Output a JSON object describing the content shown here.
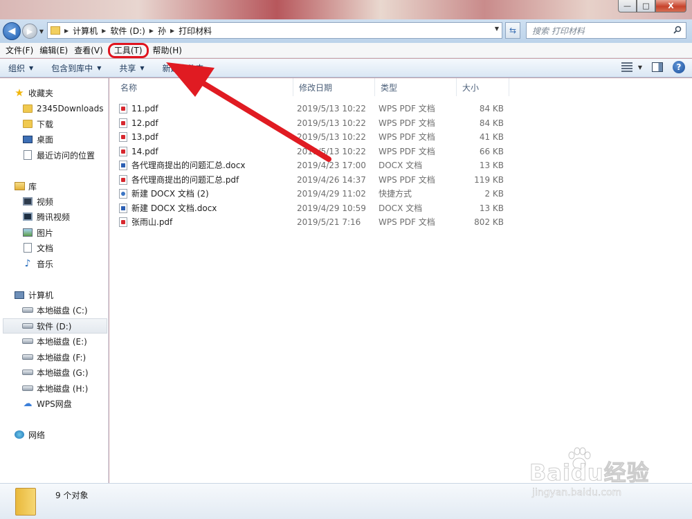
{
  "window": {
    "caption_buttons": {
      "minimize": "—",
      "maximize": "□",
      "close": "X"
    }
  },
  "address_bar": {
    "crumbs": [
      "计算机",
      "软件 (D:)",
      "孙",
      "打印材料"
    ],
    "search_placeholder": "搜索 打印材料"
  },
  "menu": {
    "items": [
      "文件(F)",
      "编辑(E)",
      "查看(V)",
      "工具(T)",
      "帮助(H)"
    ],
    "highlighted": "工具(T)"
  },
  "toolbar": {
    "organize": "组织",
    "include_library": "包含到库中",
    "share": "共享",
    "new_folder": "新建文件夹"
  },
  "nav": {
    "favorites": {
      "label": "收藏夹",
      "items": [
        "2345Downloads",
        "下载",
        "桌面",
        "最近访问的位置"
      ]
    },
    "libraries": {
      "label": "库",
      "items": [
        "视频",
        "腾讯视频",
        "图片",
        "文档",
        "音乐"
      ]
    },
    "computer": {
      "label": "计算机",
      "items": [
        "本地磁盘 (C:)",
        "软件 (D:)",
        "本地磁盘 (E:)",
        "本地磁盘 (F:)",
        "本地磁盘 (G:)",
        "本地磁盘 (H:)",
        "WPS网盘"
      ],
      "selected": "软件 (D:)"
    },
    "network": {
      "label": "网络"
    }
  },
  "columns": {
    "name": "名称",
    "date": "修改日期",
    "type": "类型",
    "size": "大小"
  },
  "files": [
    {
      "name": "11.pdf",
      "date": "2019/5/13 10:22",
      "type": "WPS PDF 文档",
      "size": "84 KB",
      "icon": "pdf"
    },
    {
      "name": "12.pdf",
      "date": "2019/5/13 10:22",
      "type": "WPS PDF 文档",
      "size": "84 KB",
      "icon": "pdf"
    },
    {
      "name": "13.pdf",
      "date": "2019/5/13 10:22",
      "type": "WPS PDF 文档",
      "size": "41 KB",
      "icon": "pdf"
    },
    {
      "name": "14.pdf",
      "date": "2019/5/13 10:22",
      "type": "WPS PDF 文档",
      "size": "66 KB",
      "icon": "pdf"
    },
    {
      "name": "各代理商提出的问题汇总.docx",
      "date": "2019/4/23 17:00",
      "type": "DOCX 文档",
      "size": "13 KB",
      "icon": "docx"
    },
    {
      "name": "各代理商提出的问题汇总.pdf",
      "date": "2019/4/26 14:37",
      "type": "WPS PDF 文档",
      "size": "119 KB",
      "icon": "pdf"
    },
    {
      "name": "新建 DOCX 文档 (2)",
      "date": "2019/4/29 11:02",
      "type": "快捷方式",
      "size": "2 KB",
      "icon": "lnk"
    },
    {
      "name": "新建 DOCX 文档.docx",
      "date": "2019/4/29 10:59",
      "type": "DOCX 文档",
      "size": "13 KB",
      "icon": "docx"
    },
    {
      "name": "张雨山.pdf",
      "date": "2019/5/21 7:16",
      "type": "WPS PDF 文档",
      "size": "802 KB",
      "icon": "pdf"
    }
  ],
  "status": {
    "count": "9 个对象"
  },
  "watermark": {
    "logo": "Baidu经验",
    "url": "jingyan.baidu.com"
  },
  "colors": {
    "highlight": "#e0141e",
    "arrow": "#e01b22",
    "accent": "#1e395b"
  }
}
